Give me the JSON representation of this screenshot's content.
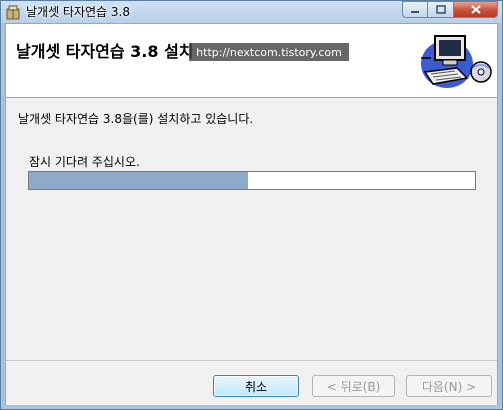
{
  "window": {
    "title": "날개셋 타자연습 3.8",
    "icon": "installer-package-icon"
  },
  "caption_buttons": {
    "minimize_icon": "minimize-icon",
    "maximize_icon": "maximize-icon",
    "close_icon": "close-icon"
  },
  "banner": {
    "title": "날개셋 타자연습 3.8 설치",
    "watermark": "http://nextcom.tistory.com",
    "art_icon": "computer-setup-icon"
  },
  "body": {
    "status": "날개셋 타자연습 3.8을(를) 설치하고 있습니다.",
    "wait": "잠시 기다려 주십시오."
  },
  "progress": {
    "fraction": 0.49,
    "fill_color": "#8fa9c9"
  },
  "buttons": {
    "cancel": "취소",
    "back": "< 뒤로(B)",
    "next": "다음(N) >"
  }
}
